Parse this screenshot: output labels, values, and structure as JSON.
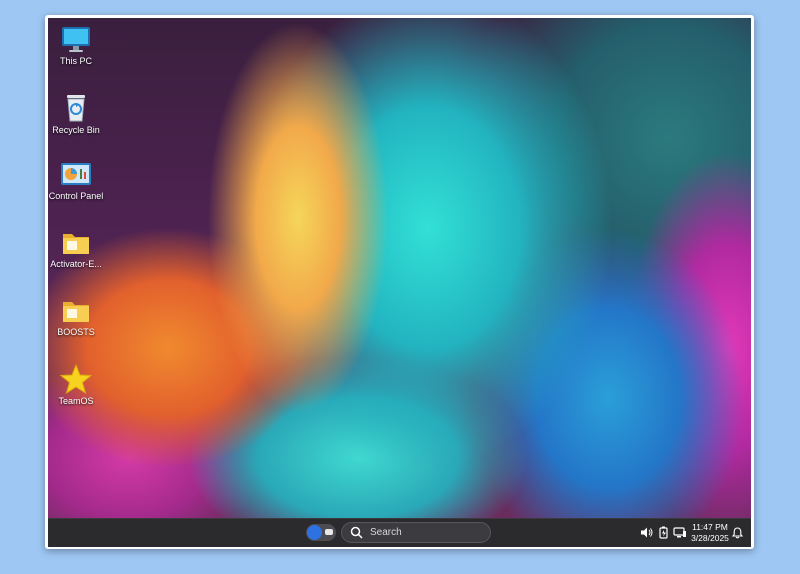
{
  "desktop": {
    "icons": [
      {
        "label": "This PC",
        "icon": "monitor-icon"
      },
      {
        "label": "Recycle Bin",
        "icon": "recycle-bin-icon"
      },
      {
        "label": "Control Panel",
        "icon": "control-panel-icon"
      },
      {
        "label": "Activator-E...",
        "icon": "folder-icon"
      },
      {
        "label": "BOOSTS",
        "icon": "folder-icon"
      },
      {
        "label": "TeamOS",
        "icon": "star-icon"
      }
    ]
  },
  "taskbar": {
    "search_placeholder": "Search",
    "tray_icons": [
      "volume-icon",
      "battery-icon",
      "network-icon"
    ],
    "time": "11:47 PM",
    "date": "3/28/2025",
    "notification_icon": "bell-icon"
  },
  "colors": {
    "page_background": "#9ec7f4",
    "taskbar": "#2b2b2e",
    "toggle_accent": "#2d72e0",
    "folder": "#f5c84a",
    "star": "#f7d21e"
  }
}
